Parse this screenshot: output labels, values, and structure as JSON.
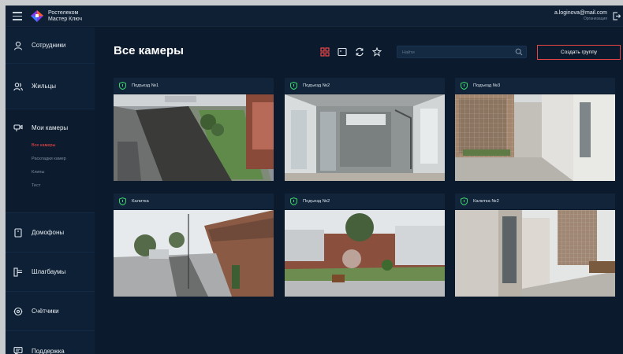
{
  "header": {
    "brand_line1": "Ростелеком",
    "brand_line2": "Мастер Ключ",
    "user_email": "a.loginova@mail.com",
    "user_org": "Организация"
  },
  "sidebar": {
    "items": [
      {
        "label": "Сотрудники",
        "icon": "person-icon"
      },
      {
        "label": "Жильцы",
        "icon": "residents-icon"
      },
      {
        "label": "Мои камеры",
        "icon": "camera-icon",
        "active": true
      },
      {
        "label": "Домофоны",
        "icon": "intercom-icon"
      },
      {
        "label": "Шлагбаумы",
        "icon": "barrier-icon"
      },
      {
        "label": "Счётчики",
        "icon": "meter-icon"
      },
      {
        "label": "Поддержка",
        "icon": "support-icon"
      }
    ],
    "camera_subitems": [
      {
        "label": "Все камеры",
        "current": true
      },
      {
        "label": "Раскладки камер"
      },
      {
        "label": "Клипы"
      },
      {
        "label": "Тест"
      }
    ]
  },
  "main": {
    "title": "Все камеры",
    "search_placeholder": "Найти",
    "create_group_label": "Создать группу",
    "accent": "#ff4b4b",
    "cameras": [
      {
        "name": "Подъезд №1"
      },
      {
        "name": "Подъезд №2"
      },
      {
        "name": "Подъезд №3"
      },
      {
        "name": "Калитка"
      },
      {
        "name": "Подъезд №2"
      },
      {
        "name": "Калитка №2"
      }
    ]
  }
}
